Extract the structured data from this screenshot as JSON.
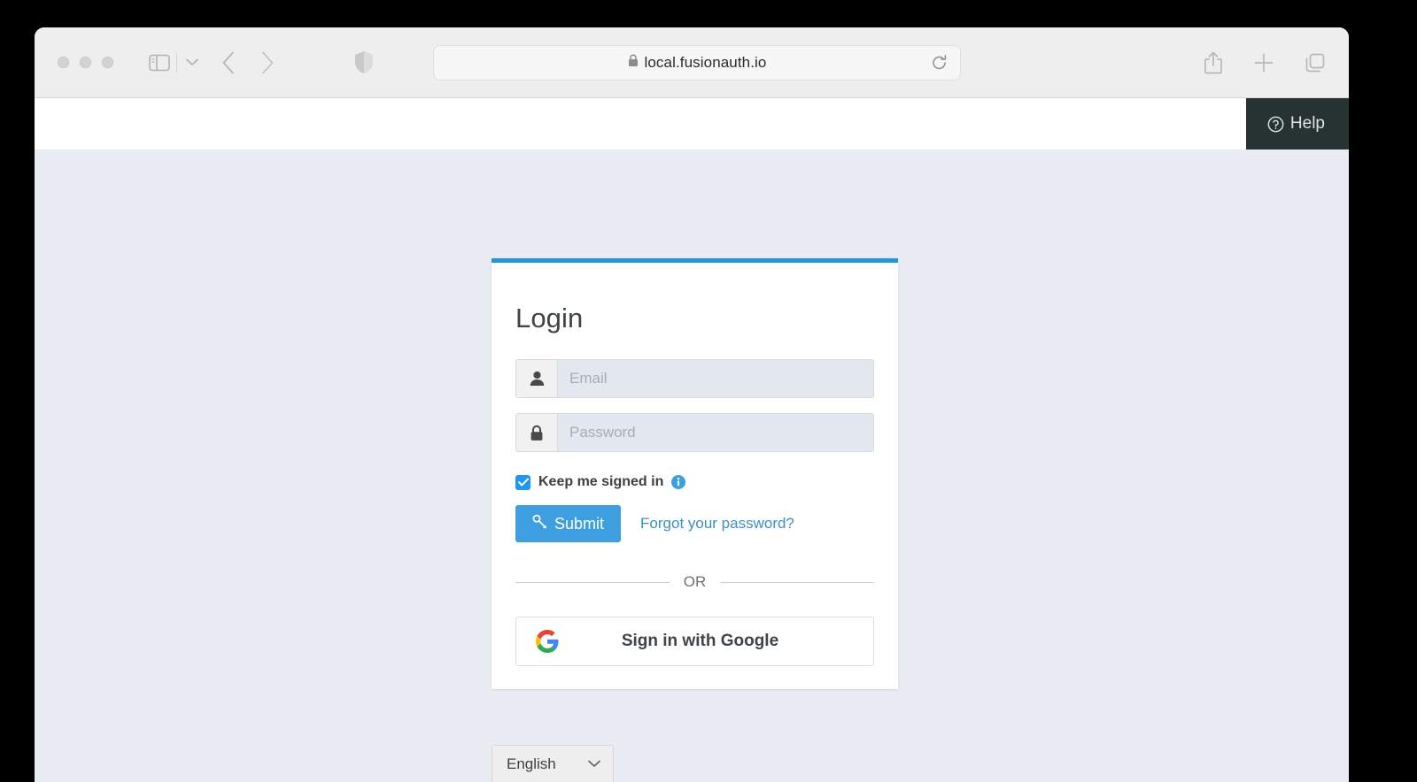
{
  "browser": {
    "url": "local.fusionauth.io",
    "lock_icon": "lock-icon",
    "reload_icon": "reload-icon",
    "traffic_lights": [
      "close-button",
      "minimize-button",
      "maximize-button"
    ],
    "sidebar_toggle_icon": "sidebar-toggle-icon",
    "sidebar_caret_icon": "chevron-down-icon",
    "back_icon": "chevron-left-icon",
    "forward_icon": "chevron-right-icon",
    "shield_icon": "shield-icon",
    "share_icon": "share-icon",
    "new_tab_icon": "plus-icon",
    "tab_overview_icon": "tab-overview-icon"
  },
  "page": {
    "help": {
      "label": "Help",
      "icon": "question-circle-icon",
      "background": "#273333"
    },
    "background": "#e9edf3",
    "accent": "#2196d3"
  },
  "login": {
    "title": "Login",
    "email": {
      "placeholder": "Email",
      "value": "",
      "icon": "user-icon"
    },
    "password": {
      "placeholder": "Password",
      "value": "",
      "icon": "lock-icon"
    },
    "keep_signed_in": {
      "label": "Keep me signed in",
      "checked": true,
      "info_icon": "info-circle-icon",
      "checkbox_color": "#2196f3"
    },
    "submit": {
      "label": "Submit",
      "icon": "key-icon",
      "color": "#3d9ee0"
    },
    "forgot_password": {
      "label": "Forgot your password?",
      "color": "#3d8fc4"
    },
    "divider_text": "OR",
    "google": {
      "label": "Sign in with Google",
      "icon": "google-g-icon"
    }
  },
  "language": {
    "selected": "English",
    "chevron_icon": "chevron-down-icon"
  }
}
